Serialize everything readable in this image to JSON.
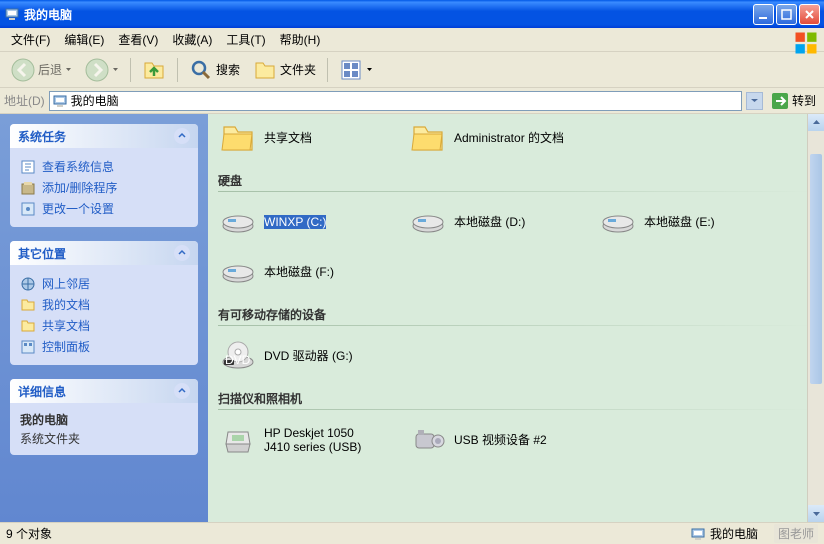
{
  "window": {
    "title": "我的电脑"
  },
  "menu": {
    "file": "文件(F)",
    "edit": "编辑(E)",
    "view": "查看(V)",
    "favorites": "收藏(A)",
    "tools": "工具(T)",
    "help": "帮助(H)"
  },
  "toolbar": {
    "back": "后退",
    "search": "搜索",
    "folders": "文件夹"
  },
  "address": {
    "label": "地址(D)",
    "value": "我的电脑",
    "go": "转到"
  },
  "sidebar": {
    "tasks": {
      "title": "系统任务",
      "items": [
        "查看系统信息",
        "添加/删除程序",
        "更改一个设置"
      ]
    },
    "other": {
      "title": "其它位置",
      "items": [
        "网上邻居",
        "我的文档",
        "共享文档",
        "控制面板"
      ]
    },
    "details": {
      "title": "详细信息",
      "name": "我的电脑",
      "type": "系统文件夹"
    }
  },
  "main": {
    "files_header": "",
    "files": [
      {
        "label": "共享文档"
      },
      {
        "label": "Administrator 的文档"
      }
    ],
    "disks_header": "硬盘",
    "disks": [
      {
        "label": "WINXP (C:)",
        "selected": true
      },
      {
        "label": "本地磁盘 (D:)"
      },
      {
        "label": "本地磁盘 (E:)"
      },
      {
        "label": "本地磁盘 (F:)"
      }
    ],
    "removable_header": "有可移动存储的设备",
    "removable": [
      {
        "label": "DVD 驱动器 (G:)"
      }
    ],
    "scanners_header": "扫描仪和照相机",
    "scanners": [
      {
        "label": "HP Deskjet 1050 J410 series (USB)"
      },
      {
        "label": "USB 视频设备 #2"
      }
    ]
  },
  "status": {
    "count": "9 个对象",
    "location": "我的电脑"
  },
  "watermark": "图老师"
}
